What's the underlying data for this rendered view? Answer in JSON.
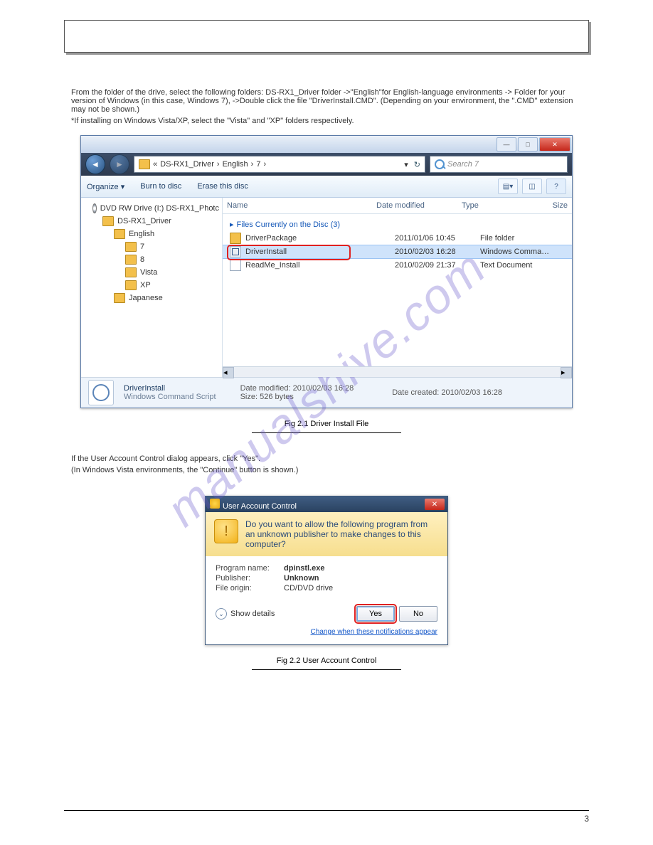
{
  "header": {
    "title": ""
  },
  "instruction_1": "From the folder of the drive, select the following folders: DS-RX1_Driver folder ->\"English\"for English-language environments -> Folder for your version of Windows (in this case, Windows 7), ->Double click the file \"DriverInstall.CMD\". (Depending on your environment, the \".CMD\" extension may not be shown.)",
  "instruction_2": "*If installing on Windows Vista/XP, select the \"Vista\" and \"XP\" folders respectively.",
  "explorer": {
    "breadcrumb": [
      "DS-RX1_Driver",
      "English",
      "7"
    ],
    "breadcrumb_prefix": "«",
    "search_placeholder": "Search 7",
    "toolbar": {
      "organize": "Organize ▾",
      "burn": "Burn to disc",
      "erase": "Erase this disc",
      "help_icon": "?"
    },
    "tree": {
      "items": [
        {
          "label": "DVD RW Drive (I:) DS-RX1_Photc",
          "icon": "disc",
          "indent": 0
        },
        {
          "label": "DS-RX1_Driver",
          "icon": "folder",
          "indent": 1
        },
        {
          "label": "English",
          "icon": "folder",
          "indent": 2
        },
        {
          "label": "7",
          "icon": "folder",
          "indent": 3
        },
        {
          "label": "8",
          "icon": "folder",
          "indent": 3
        },
        {
          "label": "Vista",
          "icon": "folder",
          "indent": 3
        },
        {
          "label": "XP",
          "icon": "folder",
          "indent": 3
        },
        {
          "label": "Japanese",
          "icon": "folder",
          "indent": 2
        }
      ]
    },
    "columns": {
      "name": "Name",
      "date": "Date modified",
      "type": "Type",
      "size": "Size"
    },
    "group_header": "Files Currently on the Disc (3)",
    "rows": [
      {
        "name": "DriverPackage",
        "date": "2011/01/06 10:45",
        "type": "File folder",
        "icon": "folder",
        "selected": false
      },
      {
        "name": "DriverInstall",
        "date": "2010/02/03 16:28",
        "type": "Windows Comma…",
        "icon": "bat",
        "selected": true
      },
      {
        "name": "ReadMe_Install",
        "date": "2010/02/09 21:37",
        "type": "Text Document",
        "icon": "txt",
        "selected": false
      }
    ],
    "details": {
      "name": "DriverInstall",
      "subtitle": "Windows Command Script",
      "modified_label": "Date modified:",
      "modified": "2010/02/03 16:28",
      "size_label": "Size:",
      "size": "526 bytes",
      "created_label": "Date created:",
      "created": "2010/02/03 16:28"
    }
  },
  "fig1_caption": "Fig 2.1 Driver Install File",
  "uac_instruction_1": "If the User Account Control dialog appears, click \"Yes\".",
  "uac_instruction_2": "(In Windows Vista environments, the \"Continue\" button is shown.)",
  "uac": {
    "title": "User Account Control",
    "question": "Do you want to allow the following program from an unknown publisher to make changes to this computer?",
    "fields": {
      "program_label": "Program name:",
      "program": "dpinstl.exe",
      "publisher_label": "Publisher:",
      "publisher": "Unknown",
      "origin_label": "File origin:",
      "origin": "CD/DVD drive"
    },
    "show_details": "Show details",
    "yes": "Yes",
    "no": "No",
    "link": "Change when these notifications appear"
  },
  "fig2_caption": "Fig 2.2 User Account Control",
  "watermark": "manualshive.com",
  "footer": {
    "left": "",
    "page_num": "3"
  }
}
